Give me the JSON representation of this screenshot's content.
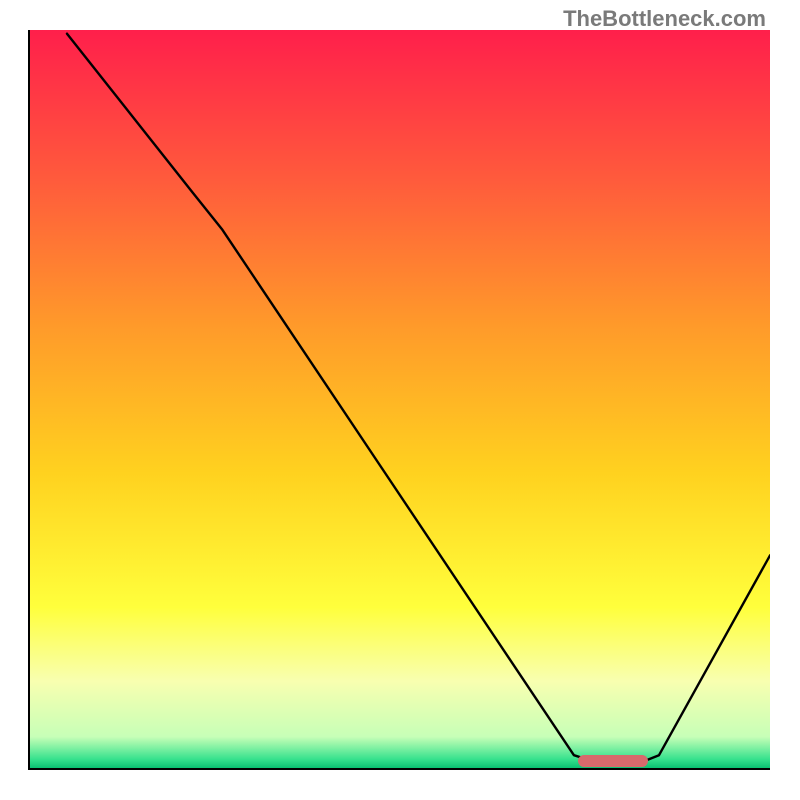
{
  "watermark": "TheBottleneck.com",
  "chart_data": {
    "type": "line",
    "title": "",
    "xlabel": "",
    "ylabel": "",
    "xlim": [
      0,
      100
    ],
    "ylim": [
      0,
      100
    ],
    "grid": false,
    "legend": false,
    "gradient_stops": [
      {
        "offset": 0.0,
        "color": "#ff1f4b"
      },
      {
        "offset": 0.2,
        "color": "#ff5a3c"
      },
      {
        "offset": 0.4,
        "color": "#ff9a2a"
      },
      {
        "offset": 0.6,
        "color": "#ffd21f"
      },
      {
        "offset": 0.78,
        "color": "#ffff3c"
      },
      {
        "offset": 0.88,
        "color": "#f8ffb0"
      },
      {
        "offset": 0.955,
        "color": "#c7ffb7"
      },
      {
        "offset": 0.985,
        "color": "#38e28e"
      },
      {
        "offset": 1.0,
        "color": "#00b86b"
      }
    ],
    "curve_points": [
      {
        "x": 5,
        "y": 99.5
      },
      {
        "x": 22,
        "y": 78
      },
      {
        "x": 26,
        "y": 73
      },
      {
        "x": 73.5,
        "y": 2
      },
      {
        "x": 76,
        "y": 1.2
      },
      {
        "x": 83,
        "y": 1.2
      },
      {
        "x": 85,
        "y": 2
      },
      {
        "x": 100,
        "y": 29
      }
    ],
    "marker": {
      "x_start": 74,
      "x_end": 83.5,
      "y": 1.2,
      "color": "#d76a6c"
    }
  }
}
